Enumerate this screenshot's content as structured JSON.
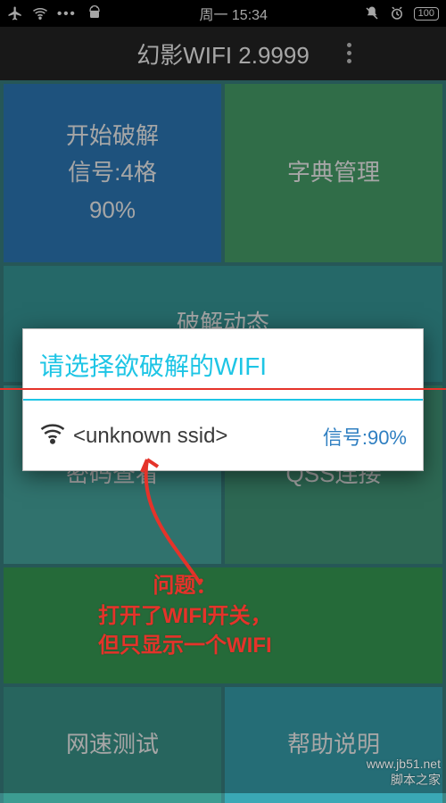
{
  "status": {
    "day_time": "周一 15:34",
    "battery": "100"
  },
  "app": {
    "title": "幻影WIFI 2.9999"
  },
  "tiles": {
    "start_crack_l1": "开始破解",
    "start_crack_l2": "信号:4格",
    "start_crack_l3": "90%",
    "dict_manage": "字典管理",
    "crack_news": "破解动态",
    "pwd_view": "密码查看",
    "qss_connect": "QSS连接",
    "speed_test": "网速测试",
    "help": "帮助说明"
  },
  "dialog": {
    "title": "请选择欲破解的WIFI",
    "items": [
      {
        "ssid": "<unknown ssid>",
        "signal_label": "信号:90%"
      }
    ]
  },
  "annotation": {
    "line1": "问题：",
    "line2": "打开了WIFI开关，",
    "line3": "但只显示一个WIFI"
  },
  "watermark": {
    "line1": "www.jb51.net",
    "line2": "脚本之家"
  }
}
